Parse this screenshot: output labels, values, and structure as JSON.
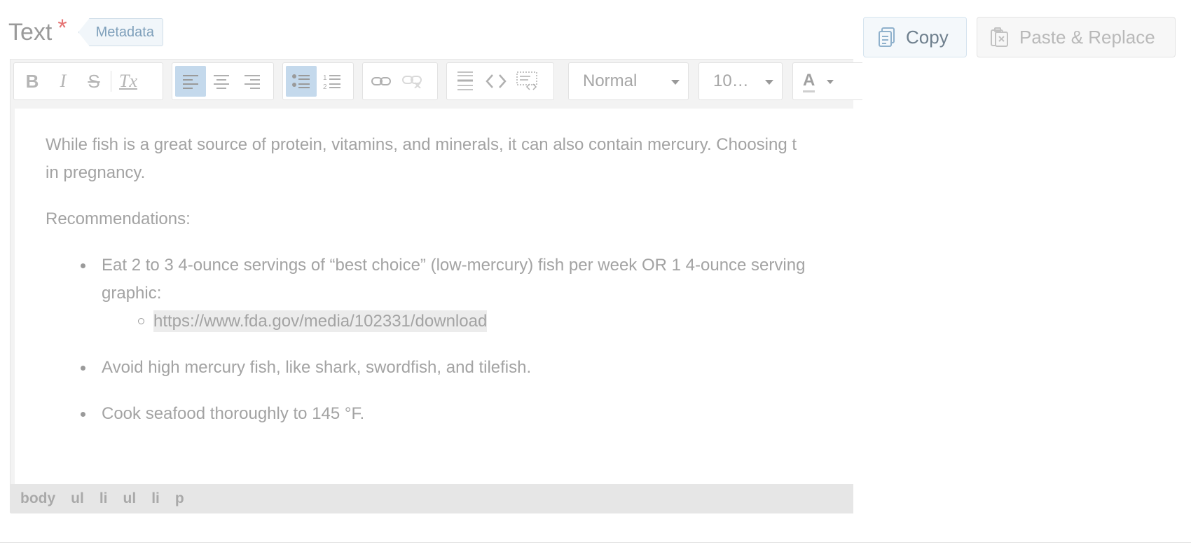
{
  "field": {
    "title": "Text",
    "required_mark": "*",
    "metadata_tag": "Metadata"
  },
  "actions": {
    "copy_label": "Copy",
    "paste_label": "Paste & Replace"
  },
  "toolbar": {
    "bold": "B",
    "italic": "I",
    "strike": "S",
    "clear_format": "Tx",
    "format_select": "Normal",
    "size_select": "10…",
    "font_color": "A",
    "active_buttons": [
      "align-left",
      "bulleted-list"
    ]
  },
  "content": {
    "paragraph1": "While fish is a great source of protein, vitamins, and minerals, it can also contain mercury. Choosing t",
    "paragraph1_cont": "in pregnancy.",
    "heading": "Recommendations:",
    "bullets": [
      "Eat 2 to 3 4-ounce servings of “best choice” (low-mercury) fish per week OR 1 4-ounce serving",
      "graphic:",
      "Avoid high mercury fish, like shark, swordfish, and tilefish.",
      "Cook seafood thoroughly to 145 °F."
    ],
    "nested_link": "https://www.fda.gov/media/102331/download"
  },
  "statusbar": {
    "path": [
      "body",
      "ul",
      "li",
      "ul",
      "li",
      "p"
    ]
  },
  "colors": {
    "active": "#c4d9ec",
    "required": "#e57373",
    "copy_text": "#6e7f8d"
  }
}
